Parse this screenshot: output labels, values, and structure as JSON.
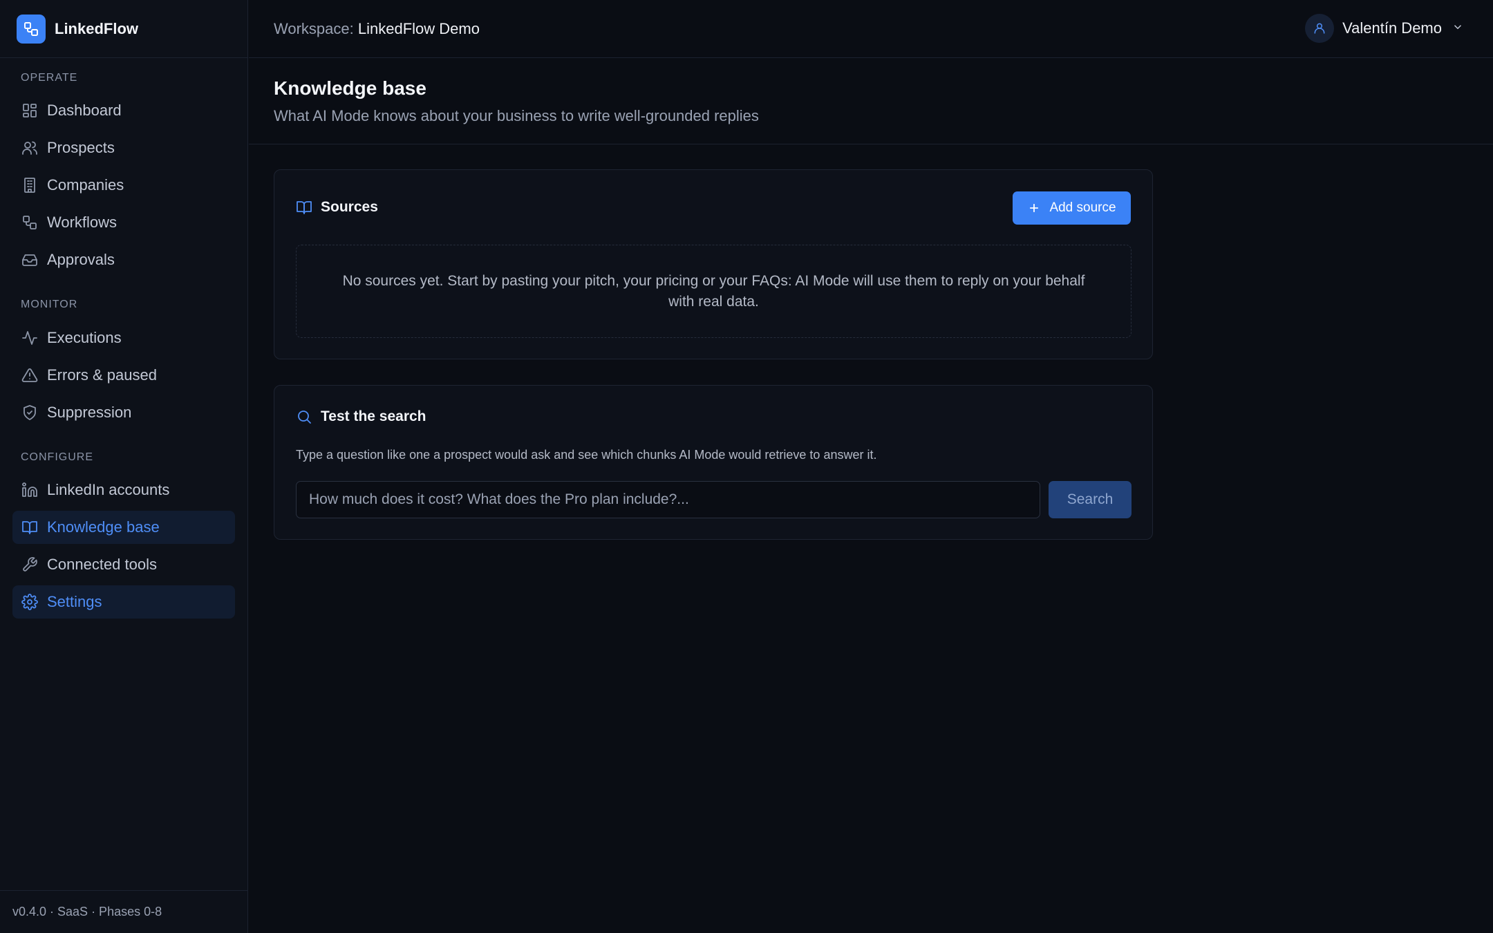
{
  "app": {
    "name": "LinkedFlow"
  },
  "sidebar": {
    "sections": [
      {
        "label": "OPERATE"
      },
      {
        "label": "MONITOR"
      },
      {
        "label": "CONFIGURE"
      }
    ],
    "items": [
      {
        "label": "Dashboard",
        "icon": "dashboard-icon"
      },
      {
        "label": "Prospects",
        "icon": "users-icon"
      },
      {
        "label": "Companies",
        "icon": "building-icon"
      },
      {
        "label": "Workflows",
        "icon": "workflow-icon"
      },
      {
        "label": "Approvals",
        "icon": "inbox-icon"
      },
      {
        "label": "Executions",
        "icon": "activity-icon"
      },
      {
        "label": "Errors & paused",
        "icon": "warning-icon"
      },
      {
        "label": "Suppression",
        "icon": "shield-icon"
      },
      {
        "label": "LinkedIn accounts",
        "icon": "linkedin-icon"
      },
      {
        "label": "Knowledge base",
        "icon": "book-icon",
        "active": true
      },
      {
        "label": "Connected tools",
        "icon": "wrench-icon"
      },
      {
        "label": "Settings",
        "icon": "gear-icon",
        "active": true
      }
    ],
    "footer": "v0.4.0 · SaaS · Phases 0-8"
  },
  "topbar": {
    "workspace_prefix": "Workspace:",
    "workspace_name": "LinkedFlow Demo",
    "user_name": "Valentín Demo"
  },
  "page": {
    "title": "Knowledge base",
    "subtitle": "What AI Mode knows about your business to write well-grounded replies"
  },
  "sources": {
    "title": "Sources",
    "add_label": "Add source",
    "empty_text": "No sources yet. Start by pasting your pitch, your pricing or your FAQs: AI Mode will use them to reply on your behalf with real data."
  },
  "test_search": {
    "title": "Test the search",
    "description": "Type a question like one a prospect would ask and see which chunks AI Mode would retrieve to answer it.",
    "placeholder": "How much does it cost? What does the Pro plan include?...",
    "value": "",
    "button_label": "Search"
  },
  "colors": {
    "accent": "#3b82f6",
    "background": "#0a0d14",
    "sidebar": "#0d1119"
  }
}
